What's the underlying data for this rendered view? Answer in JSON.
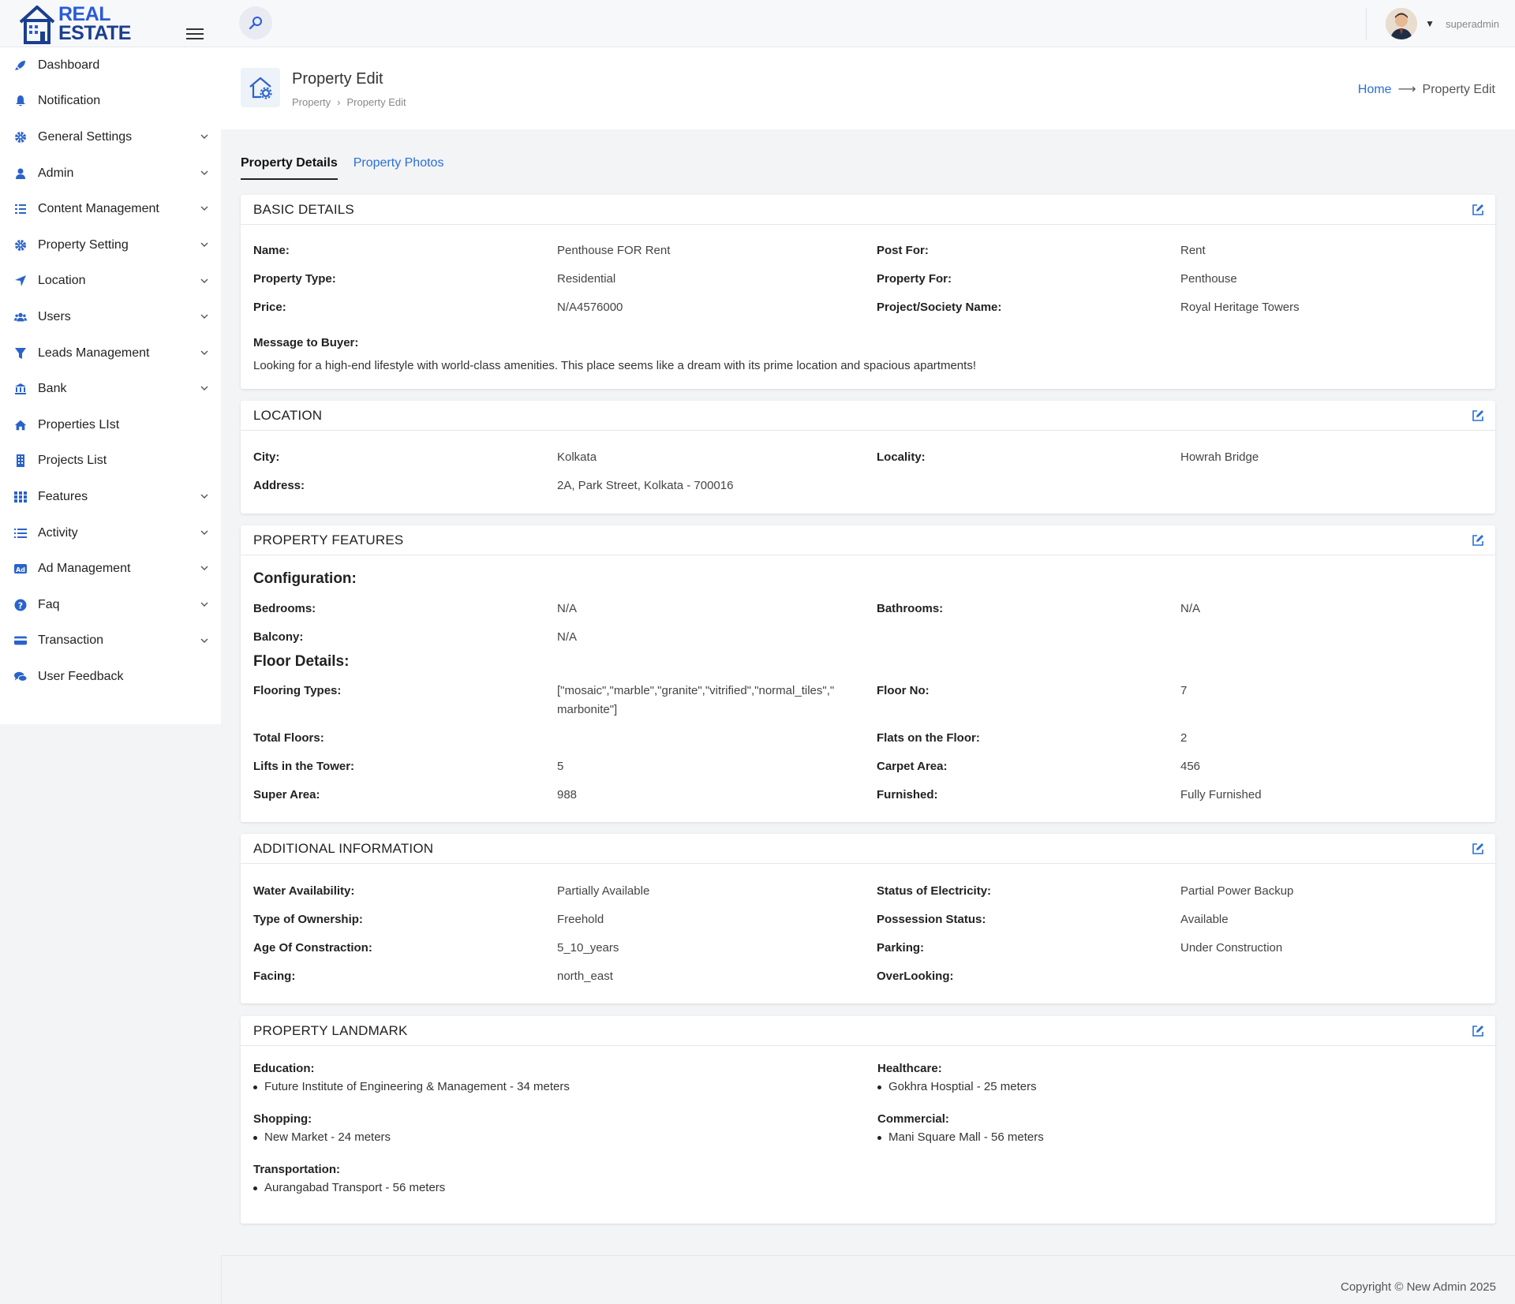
{
  "brand": {
    "line1": "REAL",
    "line2": "ESTATE"
  },
  "user": {
    "name": "superadmin"
  },
  "sidebar": {
    "items": [
      {
        "label": "Dashboard"
      },
      {
        "label": "Notification"
      },
      {
        "label": "General Settings"
      },
      {
        "label": "Admin"
      },
      {
        "label": "Content Management"
      },
      {
        "label": "Property Setting"
      },
      {
        "label": "Location"
      },
      {
        "label": "Users"
      },
      {
        "label": "Leads Management"
      },
      {
        "label": "Bank"
      },
      {
        "label": "Properties LIst"
      },
      {
        "label": "Projects List"
      },
      {
        "label": "Features"
      },
      {
        "label": "Activity"
      },
      {
        "label": "Ad Management"
      },
      {
        "label": "Faq"
      },
      {
        "label": "Transaction"
      },
      {
        "label": "User Feedback"
      }
    ]
  },
  "page": {
    "title": "Property Edit",
    "crumb_parent": "Property",
    "crumb_current": "Property Edit",
    "right_home": "Home",
    "right_current": "Property Edit"
  },
  "tabs": {
    "details": "Property Details",
    "photos": "Property Photos"
  },
  "basic": {
    "title": "BASIC DETAILS",
    "name_label": "Name:",
    "name": "Penthouse FOR Rent",
    "post_for_label": "Post For:",
    "post_for": "Rent",
    "type_label": "Property Type:",
    "type": "Residential",
    "for_label": "Property For:",
    "for": "Penthouse",
    "price_label": "Price:",
    "price": "N/A4576000",
    "project_label": "Project/Society Name:",
    "project": "Royal Heritage Towers",
    "message_label": "Message to Buyer:",
    "message": "Looking for a high-end lifestyle with world-class amenities. This place seems like a dream with its prime location and spacious apartments!"
  },
  "location": {
    "title": "LOCATION",
    "city_label": "City:",
    "city": "Kolkata",
    "locality_label": "Locality:",
    "locality": "Howrah Bridge",
    "address_label": "Address:",
    "address": "2A, Park Street, Kolkata - 700016"
  },
  "features": {
    "title": "PROPERTY FEATURES",
    "config_head": "Configuration:",
    "bedrooms_label": "Bedrooms:",
    "bedrooms": "N/A",
    "bathrooms_label": "Bathrooms:",
    "bathrooms": "N/A",
    "balcony_label": "Balcony:",
    "balcony": "N/A",
    "floor_head": "Floor Details:",
    "flooring_label": "Flooring Types:",
    "flooring_line1": "[\"mosaic\",\"marble\",\"granite\",\"vitrified\",\"normal_tiles\",\"",
    "flooring_line2": "marbonite\"]",
    "floor_no_label": "Floor No:",
    "floor_no": "7",
    "total_floors_label": "Total Floors:",
    "total_floors": "",
    "flats_label": "Flats on the Floor:",
    "flats": "2",
    "lifts_label": "Lifts in the Tower:",
    "lifts": "5",
    "carpet_label": "Carpet Area:",
    "carpet": "456",
    "super_label": "Super Area:",
    "super": "988",
    "furnished_label": "Furnished:",
    "furnished": "Fully Furnished"
  },
  "additional": {
    "title": "ADDITIONAL INFORMATION",
    "water_label": "Water Availability:",
    "water": "Partially Available",
    "electricity_label": "Status of Electricity:",
    "electricity": "Partial Power Backup",
    "ownership_label": "Type of Ownership:",
    "ownership": "Freehold",
    "possession_label": "Possession Status:",
    "possession": "Available",
    "age_label": "Age Of Constraction:",
    "age": "5_10_years",
    "parking_label": "Parking:",
    "parking": "Under Construction",
    "facing_label": "Facing:",
    "facing": "north_east",
    "overlooking_label": "OverLooking:",
    "overlooking": ""
  },
  "landmark": {
    "title": "PROPERTY LANDMARK",
    "education_label": "Education:",
    "education": "Future Institute of Engineering & Management - 34 meters",
    "healthcare_label": "Healthcare:",
    "healthcare": "Gokhra Hosptial - 25 meters",
    "shopping_label": "Shopping:",
    "shopping": "New Market - 24 meters",
    "commercial_label": "Commercial:",
    "commercial": "Mani Square Mall - 56 meters",
    "transport_label": "Transportation:",
    "transport": "Aurangabad Transport - 56 meters"
  },
  "footer": {
    "copyright": "Copyright © New Admin 2025"
  },
  "colors": {
    "accent": "#2a6fd4",
    "brand": "#1b3f8f",
    "icon": "#2a63c9"
  }
}
